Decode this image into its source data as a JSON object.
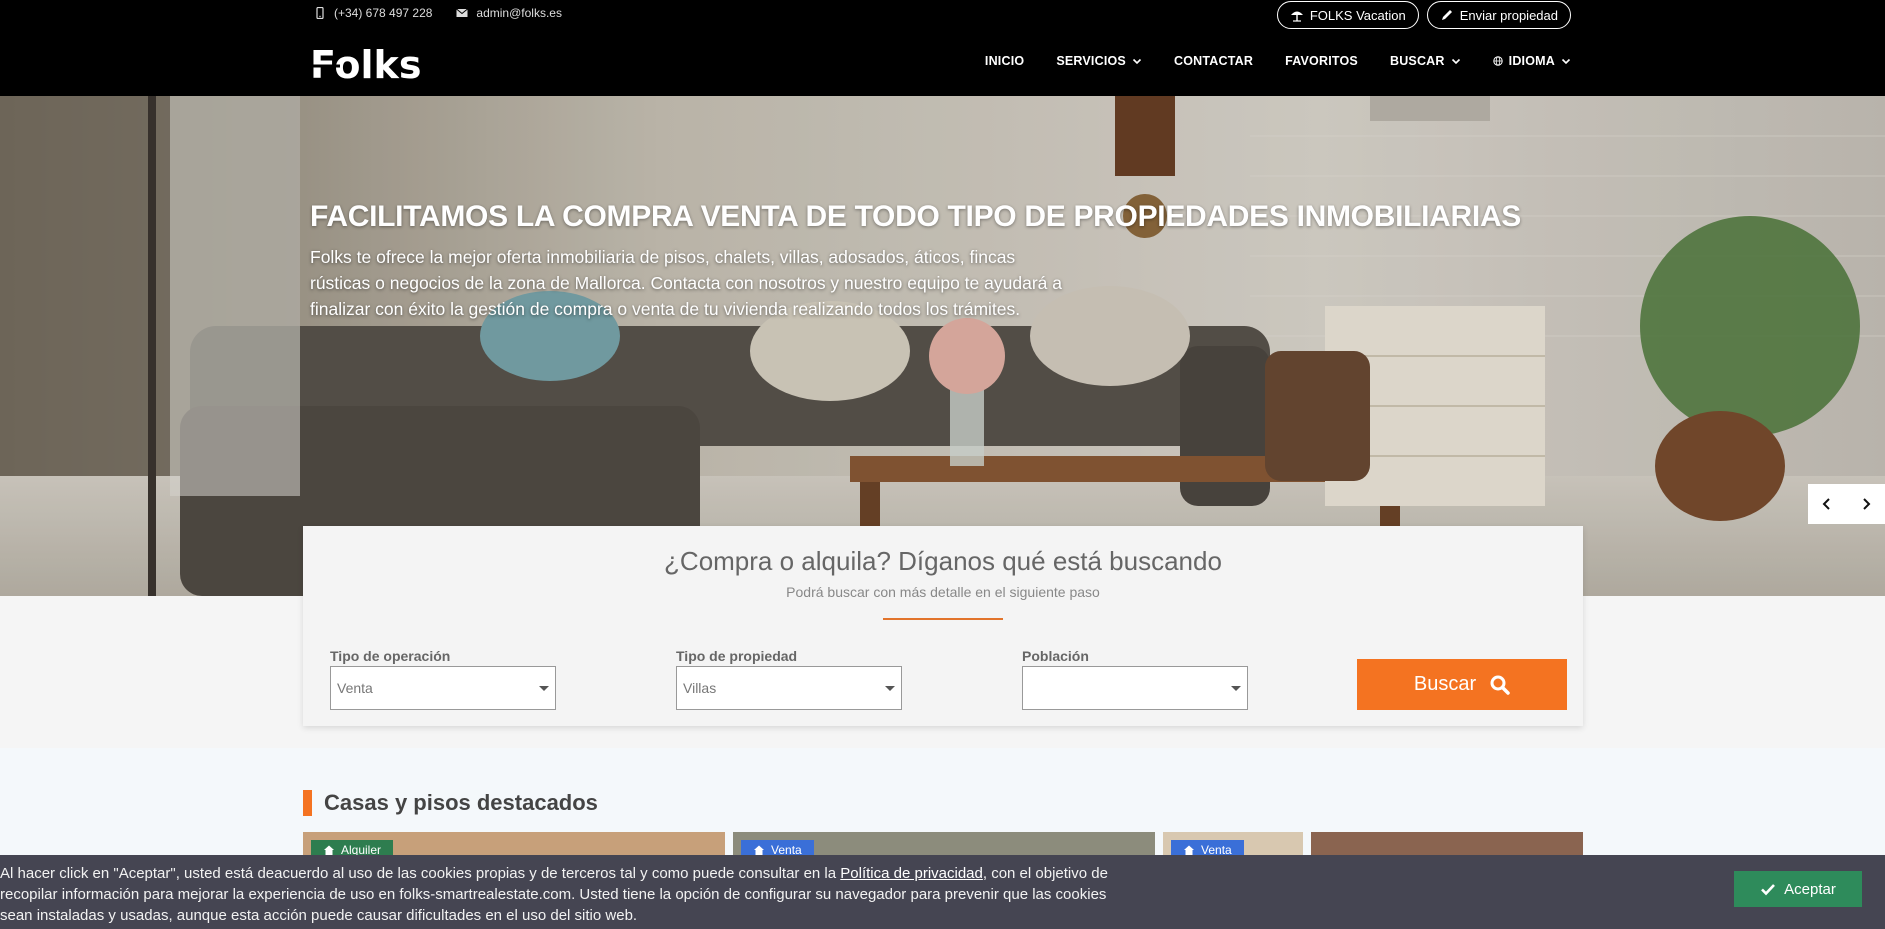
{
  "topbar": {
    "phone": "(+34) 678 497 228",
    "email": "admin@folks.es",
    "vacation_label": "FOLKS Vacation",
    "send_property_label": "Enviar propiedad",
    "logo_text": "Folks"
  },
  "nav": {
    "items": [
      {
        "label": "INICIO"
      },
      {
        "label": "SERVICIOS"
      },
      {
        "label": "CONTACTAR"
      },
      {
        "label": "FAVORITOS"
      },
      {
        "label": "BUSCAR"
      },
      {
        "label": "IDIOMA"
      }
    ]
  },
  "hero": {
    "title": "FACILITAMOS LA COMPRA VENTA DE TODO TIPO DE PROPIEDADES INMOBILIARIAS",
    "description": "Folks te ofrece la mejor oferta inmobiliaria de pisos, chalets, villas, adosados, áticos, fincas rústicas o negocios de la zona de Mallorca. Contacta con nosotros y nuestro equipo te ayudará a finalizar con éxito la gestión de compra o venta de tu vivienda realizando todos los trámites."
  },
  "search": {
    "title": "¿Compra o alquila? Díganos qué está buscando",
    "subtitle": "Podrá buscar con más detalle en el siguiente paso",
    "operation_label": "Tipo de operación",
    "operation_value": "Venta",
    "property_label": "Tipo de propiedad",
    "property_value": "Villas",
    "city_label": "Población",
    "city_value": "",
    "button_label": "Buscar"
  },
  "featured": {
    "title": "Casas y pisos destacados",
    "cards": [
      {
        "badge": "Alquiler",
        "badge_color": "#2e7d4f"
      },
      {
        "badge": "Venta",
        "badge_color": "#3a6fd8"
      },
      {
        "badge": "Venta",
        "badge_color": "#3a6fd8"
      },
      {
        "badge": "",
        "badge_color": ""
      }
    ]
  },
  "cookie": {
    "text_before": "Al hacer click en \"Aceptar\", usted está deacuerdo al uso de las cookies propias y de terceros tal y como puede consultar en la ",
    "link_text": "Política de privacidad",
    "text_after": ", con el objetivo de recopilar información para mejorar la experiencia de uso en folks-smartrealestate.com. Usted tiene la opción de configurar su navegador para prevenir que las cookies sean instaladas y usadas, aunque esta acción puede causar dificultades en el uso del sitio web.",
    "accept_label": "Aceptar"
  },
  "colors": {
    "accent": "#f47321",
    "accept": "#2e8b5b",
    "header_bg": "#000000",
    "cookie_bg": "#454552"
  }
}
